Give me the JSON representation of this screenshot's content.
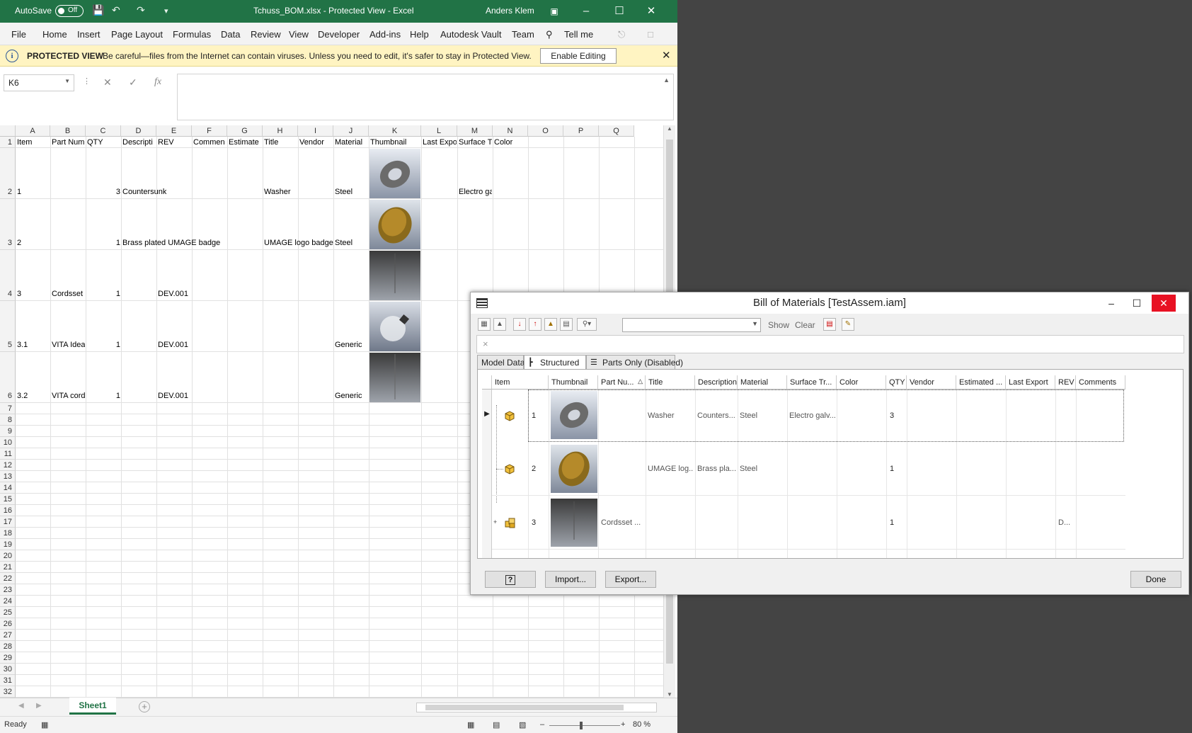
{
  "excel": {
    "autosave_label": "AutoSave",
    "autosave_state": "Off",
    "window_title": "Tchuss_BOM.xlsx  -  Protected View  -  Excel",
    "user": "Anders Klem",
    "menu": [
      "File",
      "Home",
      "Insert",
      "Page Layout",
      "Formulas",
      "Data",
      "Review",
      "View",
      "Developer",
      "Add-ins",
      "Help",
      "Autodesk Vault",
      "Team",
      "Tell me"
    ],
    "protected": {
      "label": "PROTECTED VIEW",
      "message": "Be careful—files from the Internet can contain viruses. Unless you need to edit, it's safer to stay in Protected View.",
      "button": "Enable Editing"
    },
    "name_box": "K6",
    "fx_label": "fx",
    "columns": [
      "A",
      "B",
      "C",
      "D",
      "E",
      "F",
      "G",
      "H",
      "I",
      "J",
      "K",
      "L",
      "M",
      "N",
      "O",
      "P",
      "Q"
    ],
    "header_row": [
      "Item",
      "Part Num",
      "QTY",
      "Descripti",
      "REV",
      "Commen",
      "Estimate",
      "Title",
      "Vendor",
      "Material",
      "Thumbnail",
      "Last Expo",
      "Surface T",
      "Color"
    ],
    "rows": [
      {
        "n": "2",
        "item": "1",
        "part": "",
        "qty": "3",
        "desc": "Countersunk",
        "rev": "",
        "title": "Washer",
        "material": "Steel",
        "surface": "Electro ga"
      },
      {
        "n": "3",
        "item": "2",
        "part": "",
        "qty": "1",
        "desc": "Brass plated UMAGE badge",
        "rev": "",
        "title": "UMAGE logo badge",
        "material": "Steel",
        "surface": ""
      },
      {
        "n": "4",
        "item": "3",
        "part": "Cordsset",
        "qty": "1",
        "desc": "",
        "rev": "DEV.001",
        "title": "",
        "material": "",
        "surface": ""
      },
      {
        "n": "5",
        "item": "3.1",
        "part": "VITA Idea",
        "qty": "1",
        "desc": "",
        "rev": "DEV.001",
        "title": "",
        "material": "Generic",
        "surface": ""
      },
      {
        "n": "6",
        "item": "3.2",
        "part": "VITA cord",
        "qty": "1",
        "desc": "",
        "rev": "DEV.001",
        "title": "",
        "material": "Generic",
        "surface": ""
      }
    ],
    "empty_rows": [
      "7",
      "8",
      "9",
      "10",
      "11",
      "12",
      "13",
      "14",
      "15",
      "16",
      "17",
      "18",
      "19",
      "20",
      "21",
      "22",
      "23",
      "24",
      "25",
      "26",
      "27",
      "28",
      "29",
      "30",
      "31",
      "32"
    ],
    "sheet_tab": "Sheet1",
    "status": "Ready",
    "zoom": "80 %"
  },
  "bom": {
    "title": "Bill of Materials [TestAssem.iam]",
    "show_label": "Show",
    "clear_label": "Clear",
    "tabs": [
      "Model Data",
      "Structured",
      "Parts Only (Disabled)"
    ],
    "columns": [
      "Item",
      "Thumbnail",
      "Part Nu...",
      "Title",
      "Description",
      "Material",
      "Surface Tr...",
      "Color",
      "QTY",
      "Vendor",
      "Estimated ...",
      "Last Export",
      "REV",
      "Comments"
    ],
    "rows": [
      {
        "item": "1",
        "part": "",
        "title": "Washer",
        "desc": "Counters...",
        "material": "Steel",
        "surface": "Electro galv...",
        "qty": "3",
        "rev": ""
      },
      {
        "item": "2",
        "part": "",
        "title": "UMAGE log...",
        "desc": "Brass pla...",
        "material": "Steel",
        "surface": "",
        "qty": "1",
        "rev": ""
      },
      {
        "item": "3",
        "part": "Cordsset ...",
        "title": "",
        "desc": "",
        "material": "",
        "surface": "",
        "qty": "1",
        "rev": "D..."
      }
    ],
    "buttons": {
      "help": "?",
      "import": "Import...",
      "export": "Export...",
      "done": "Done"
    }
  },
  "colors": {
    "excel_green": "#217346",
    "protected_yellow": "#fff4c2",
    "close_red": "#e81123",
    "desktop": "#444444"
  }
}
